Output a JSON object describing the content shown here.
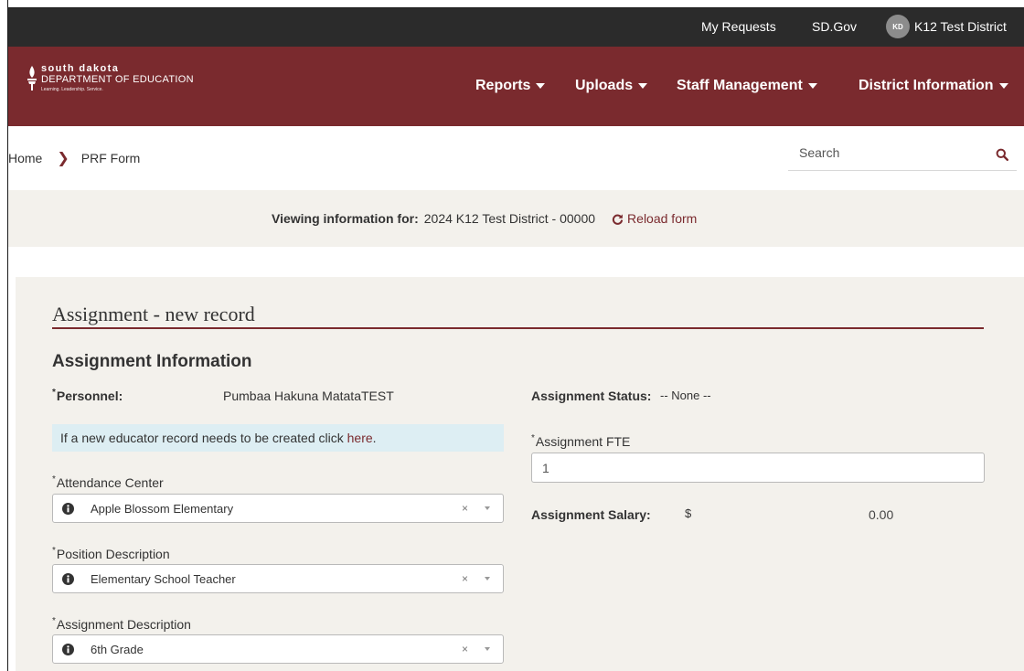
{
  "topbar": {
    "my_requests": "My Requests",
    "sd_gov": "SD.Gov",
    "avatar_initials": "KD",
    "user_name": "K12 Test District"
  },
  "logo": {
    "line1": "south dakota",
    "line2": "DEPARTMENT OF EDUCATION",
    "line3": "Learning. Leadership. Service."
  },
  "nav": {
    "items": [
      {
        "label": "Reports"
      },
      {
        "label": "Uploads"
      },
      {
        "label": "Staff Management"
      },
      {
        "label": "District Information"
      }
    ]
  },
  "breadcrumb": {
    "home": "Home",
    "current": "PRF Form"
  },
  "search": {
    "placeholder": "Search"
  },
  "banner": {
    "label": "Viewing information for:",
    "value": "2024 K12 Test District - 00000",
    "reload": "Reload form"
  },
  "form": {
    "title": "Assignment - new record",
    "section_title": "Assignment Information",
    "personnel_label": "Personnel:",
    "personnel_value": "Pumbaa Hakuna MatataTEST",
    "info_text": "If a new educator record needs to be created click ",
    "info_link": "here",
    "info_period": ".",
    "attendance_label": "Attendance Center",
    "attendance_value": "Apple Blossom Elementary",
    "position_label": "Position Description",
    "position_value": "Elementary School Teacher",
    "assignment_label": "Assignment Description",
    "assignment_value": "6th Grade",
    "status_label": "Assignment Status:",
    "status_value": "-- None --",
    "fte_label": "Assignment FTE",
    "fte_value": "1",
    "salary_label": "Assignment Salary:",
    "salary_currency": "$",
    "salary_value": "0.00",
    "required_marker": "*",
    "clear_glyph": "×"
  },
  "colors": {
    "brand": "#7a2a2e",
    "topbar": "#2b2b2b",
    "panel": "#f3f1ec",
    "info_box": "#ddeef3"
  }
}
